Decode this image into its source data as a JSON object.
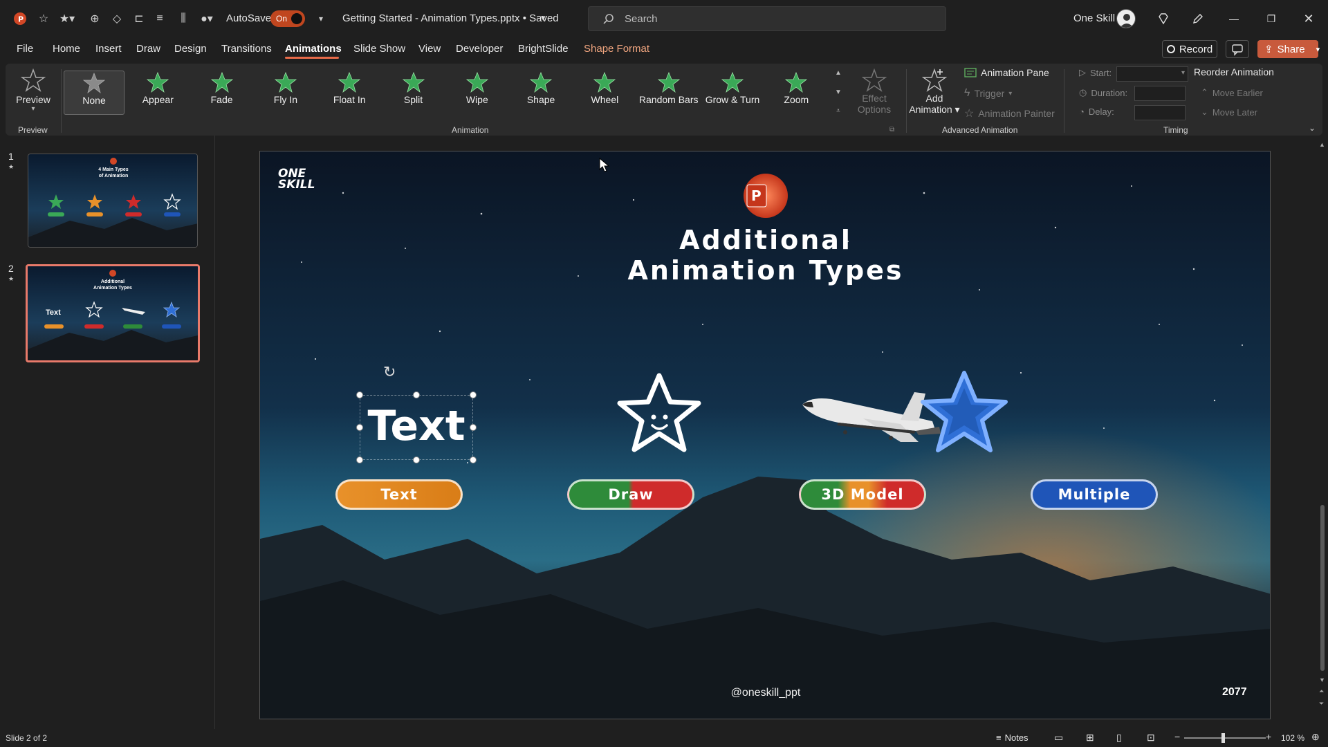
{
  "titlebar": {
    "autosave_label": "AutoSave",
    "autosave_state": "On",
    "doc_title": "Getting Started - Animation Types.pptx • Saved",
    "search_placeholder": "Search",
    "user_name": "One Skill"
  },
  "tabs": [
    "File",
    "Home",
    "Insert",
    "Draw",
    "Design",
    "Transitions",
    "Animations",
    "Slide Show",
    "View",
    "Developer",
    "BrightSlide",
    "Shape Format"
  ],
  "active_tab": "Animations",
  "actions": {
    "record": "Record",
    "share": "Share"
  },
  "ribbon": {
    "preview_label": "Preview",
    "preview_group": "Preview",
    "animation_group": "Animation",
    "gallery": [
      "None",
      "Appear",
      "Fade",
      "Fly In",
      "Float In",
      "Split",
      "Wipe",
      "Shape",
      "Wheel",
      "Random Bars",
      "Grow & Turn",
      "Zoom"
    ],
    "effect_options_1": "Effect",
    "effect_options_2": "Options",
    "add_animation_1": "Add",
    "add_animation_2": "Animation",
    "animation_pane": "Animation Pane",
    "trigger": "Trigger",
    "animation_painter": "Animation Painter",
    "advanced_group": "Advanced Animation",
    "start": "Start:",
    "duration": "Duration:",
    "delay": "Delay:",
    "timing_group": "Timing",
    "reorder": "Reorder Animation",
    "move_earlier": "Move Earlier",
    "move_later": "Move Later"
  },
  "thumbnails": [
    {
      "num": "1",
      "title_l1": "4 Main Types",
      "title_l2": "of Animation"
    },
    {
      "num": "2",
      "title_l1": "Additional",
      "title_l2": "Animation Types",
      "text": "Text"
    }
  ],
  "slide": {
    "logo_l1": "ONE",
    "logo_l2": "SKILL",
    "title_l1": "Additional",
    "title_l2": "Animation Types",
    "big_text": "Text",
    "buttons": [
      "Text",
      "Draw",
      "3D Model",
      "Multiple"
    ],
    "handle": "@oneskill_ppt",
    "year": "2077"
  },
  "status": {
    "slide_info": "Slide 2 of 2",
    "notes": "Notes",
    "zoom": "102 %"
  },
  "colors": {
    "accent": "#c0461f",
    "orange": "#e8912a",
    "green": "#2e8b3a",
    "red": "#cf2b2b",
    "blue": "#1f55b8",
    "star_green": "#3aa957"
  }
}
